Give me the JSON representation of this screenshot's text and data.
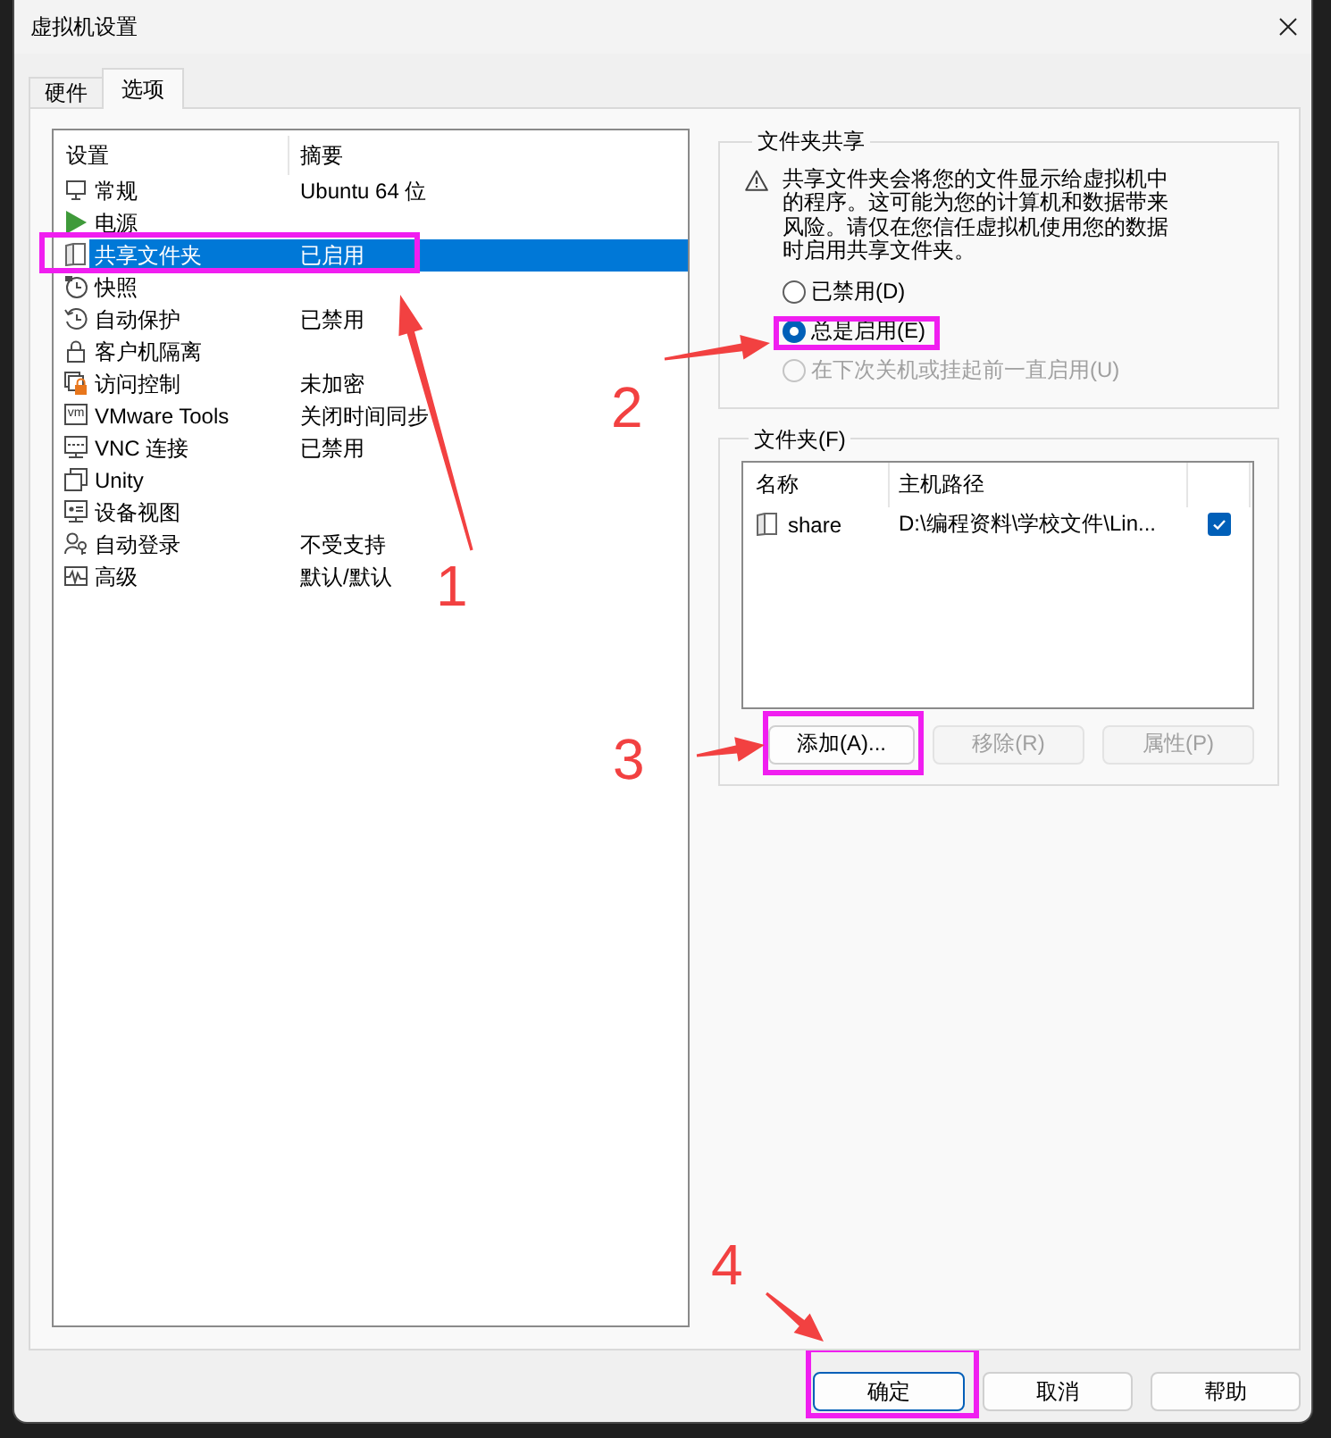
{
  "window": {
    "title": "虚拟机设置"
  },
  "tabs": [
    {
      "label": "硬件",
      "selected": false
    },
    {
      "label": "选项",
      "selected": true
    }
  ],
  "settings": {
    "columns": [
      "设置",
      "摘要"
    ],
    "rows": [
      {
        "name": "常规",
        "summary": "Ubuntu 64 位",
        "selected": false,
        "highlighted": false
      },
      {
        "name": "电源",
        "selected": false,
        "highlighted": false
      },
      {
        "name": "共享文件夹",
        "summary": "已启用",
        "selected": true,
        "highlighted": true
      },
      {
        "name": "快照",
        "selected": false,
        "highlighted": false
      },
      {
        "name": "自动保护",
        "summary": "已禁用",
        "selected": false,
        "highlighted": false
      },
      {
        "name": "客户机隔离",
        "selected": false,
        "highlighted": false
      },
      {
        "name": "访问控制",
        "summary": "未加密",
        "selected": false,
        "highlighted": false
      },
      {
        "name": "VMware Tools",
        "summary": "关闭时间同步",
        "icon_label": "vm",
        "selected": false,
        "highlighted": false
      },
      {
        "name": "VNC 连接",
        "summary": "已禁用",
        "selected": false,
        "highlighted": false
      },
      {
        "name": "Unity",
        "selected": false,
        "highlighted": false
      },
      {
        "name": "设备视图",
        "selected": false,
        "highlighted": false
      },
      {
        "name": "自动登录",
        "summary": "不受支持",
        "selected": false,
        "highlighted": false
      },
      {
        "name": "高级",
        "summary": "默认/默认",
        "selected": false,
        "highlighted": false
      }
    ]
  },
  "folder_sharing": {
    "title": "文件夹共享",
    "warning": "共享文件夹会将您的文件显示给虚拟机中的程序。这可能为您的计算机和数据带来风险。请仅在您信任虚拟机使用您的数据时启用共享文件夹。",
    "options": [
      {
        "label": "已禁用(D)",
        "selected": false,
        "disabled": false,
        "highlighted": false
      },
      {
        "label": "总是启用(E)",
        "selected": true,
        "disabled": false,
        "highlighted": true
      },
      {
        "label": "在下次关机或挂起前一直启用(U)",
        "selected": false,
        "disabled": true,
        "highlighted": false
      }
    ]
  },
  "folders": {
    "title": "文件夹(F)",
    "columns": [
      "名称",
      "主机路径"
    ],
    "rows": [
      {
        "name": "share",
        "host_path": "D:\\编程资料\\学校文件\\Lin...",
        "checked": true
      }
    ],
    "buttons": [
      {
        "label": "添加(A)...",
        "disabled": false,
        "highlighted": true
      },
      {
        "label": "移除(R)",
        "disabled": true,
        "highlighted": false
      },
      {
        "label": "属性(P)",
        "disabled": true,
        "highlighted": false
      }
    ]
  },
  "buttons": [
    {
      "label": "确定",
      "default": true,
      "highlighted": true
    },
    {
      "label": "取消",
      "default": false,
      "highlighted": false
    },
    {
      "label": "帮助",
      "default": false,
      "highlighted": false
    }
  ],
  "annotations": [
    {
      "label": "1"
    },
    {
      "label": "2"
    },
    {
      "label": "3"
    },
    {
      "label": "4"
    }
  ]
}
